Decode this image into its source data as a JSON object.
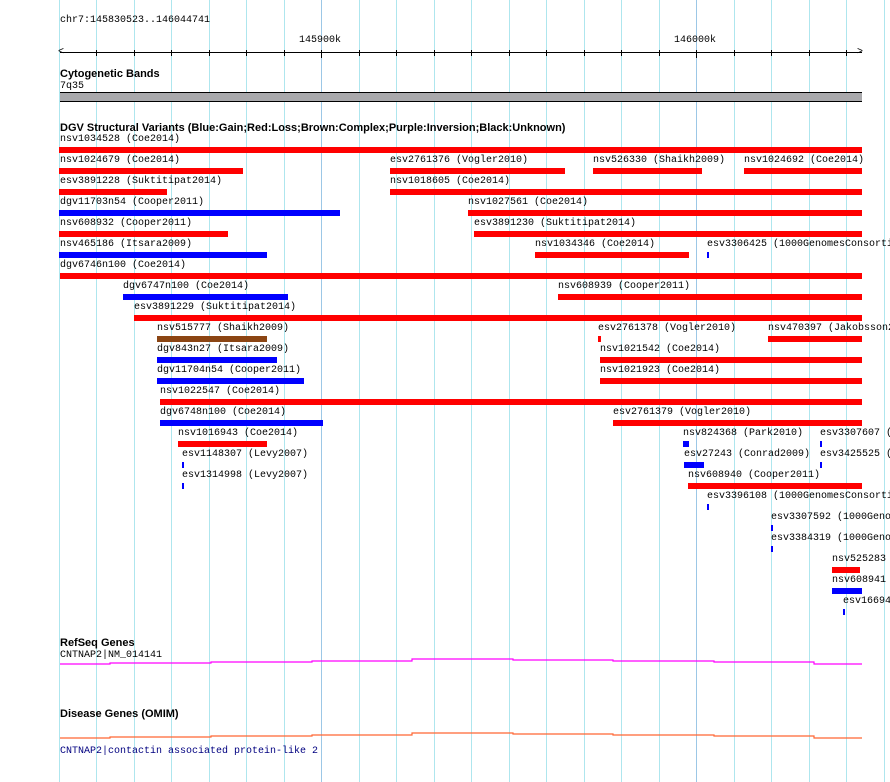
{
  "ruler": {
    "region": "chr7:145830523..146044741",
    "tick_labels": [
      "145900k",
      "146000k"
    ]
  },
  "cytoband": {
    "title": "Cytogenetic Bands",
    "band": "7q35",
    "band_color": "#a9a9ac"
  },
  "dgv": {
    "title": "DGV Structural Variants (Blue:Gain;Red:Loss;Brown:Complex;Purple:Inversion;Black:Unknown)",
    "colors": {
      "gain": "#0000ff",
      "loss": "#ff0000",
      "complex": "#8b4513"
    },
    "features": [
      {
        "label": "nsv1034528 (Coe2014)",
        "type": "loss"
      },
      {
        "label": "nsv1024679 (Coe2014)",
        "type": "loss"
      },
      {
        "label": "esv2761376 (Vogler2010)",
        "type": "loss"
      },
      {
        "label": "nsv526330 (Shaikh2009)",
        "type": "loss"
      },
      {
        "label": "nsv1024692 (Coe2014)",
        "type": "loss"
      },
      {
        "label": "esv3891228 (Suktitipat2014)",
        "type": "loss"
      },
      {
        "label": "nsv1018605 (Coe2014)",
        "type": "loss"
      },
      {
        "label": "dgv11703n54 (Cooper2011)",
        "type": "gain"
      },
      {
        "label": "nsv1027561 (Coe2014)",
        "type": "loss"
      },
      {
        "label": "nsv608932 (Cooper2011)",
        "type": "loss"
      },
      {
        "label": "esv3891230 (Suktitipat2014)",
        "type": "loss"
      },
      {
        "label": "nsv465186 (Itsara2009)",
        "type": "gain"
      },
      {
        "label": "nsv1034346 (Coe2014)",
        "type": "loss"
      },
      {
        "label": "esv3306425 (1000GenomesConsorti",
        "type": "gain"
      },
      {
        "label": "dgv6746n100 (Coe2014)",
        "type": "loss"
      },
      {
        "label": "dgv6747n100 (Coe2014)",
        "type": "gain"
      },
      {
        "label": "nsv608939 (Cooper2011)",
        "type": "loss"
      },
      {
        "label": "esv3891229 (Suktitipat2014)",
        "type": "loss"
      },
      {
        "label": "nsv515777 (Shaikh2009)",
        "type": "complex"
      },
      {
        "label": "esv2761378 (Vogler2010)",
        "type": "loss"
      },
      {
        "label": "nsv470397 (Jakobsson2",
        "type": "loss"
      },
      {
        "label": "dgv843n27 (Itsara2009)",
        "type": "gain"
      },
      {
        "label": "nsv1021542 (Coe2014)",
        "type": "loss"
      },
      {
        "label": "dgv11704n54 (Cooper2011)",
        "type": "gain"
      },
      {
        "label": "nsv1021923 (Coe2014)",
        "type": "loss"
      },
      {
        "label": "nsv1022547 (Coe2014)",
        "type": "loss"
      },
      {
        "label": "dgv6748n100 (Coe2014)",
        "type": "gain"
      },
      {
        "label": "esv2761379 (Vogler2010)",
        "type": "loss"
      },
      {
        "label": "nsv1016943 (Coe2014)",
        "type": "loss"
      },
      {
        "label": "nsv824368 (Park2010)",
        "type": "gain"
      },
      {
        "label": "esv3307607 (",
        "type": "gain"
      },
      {
        "label": "esv1148307 (Levy2007)",
        "type": "gain"
      },
      {
        "label": "esv27243 (Conrad2009)",
        "type": "gain"
      },
      {
        "label": "esv3425525 (",
        "type": "gain"
      },
      {
        "label": "esv1314998 (Levy2007)",
        "type": "gain"
      },
      {
        "label": "nsv608940 (Cooper2011)",
        "type": "loss"
      },
      {
        "label": "esv3396108 (1000GenomesConsorti",
        "type": "gain"
      },
      {
        "label": "esv3307592 (1000Geno",
        "type": "gain"
      },
      {
        "label": "esv3384319 (1000Geno",
        "type": "gain"
      },
      {
        "label": "nsv525283",
        "type": "loss"
      },
      {
        "label": "nsv608941",
        "type": "gain"
      },
      {
        "label": "esv16694",
        "type": "gain"
      }
    ]
  },
  "refseq": {
    "title": "RefSeq Genes",
    "gene": "CNTNAP2|NM_014141",
    "color": "#ff00ff"
  },
  "omim": {
    "title": "Disease Genes (OMIM)",
    "gene": "CNTNAP2|contactin associated protein-like 2",
    "color": "#ff6633",
    "text_color": "#000080"
  }
}
